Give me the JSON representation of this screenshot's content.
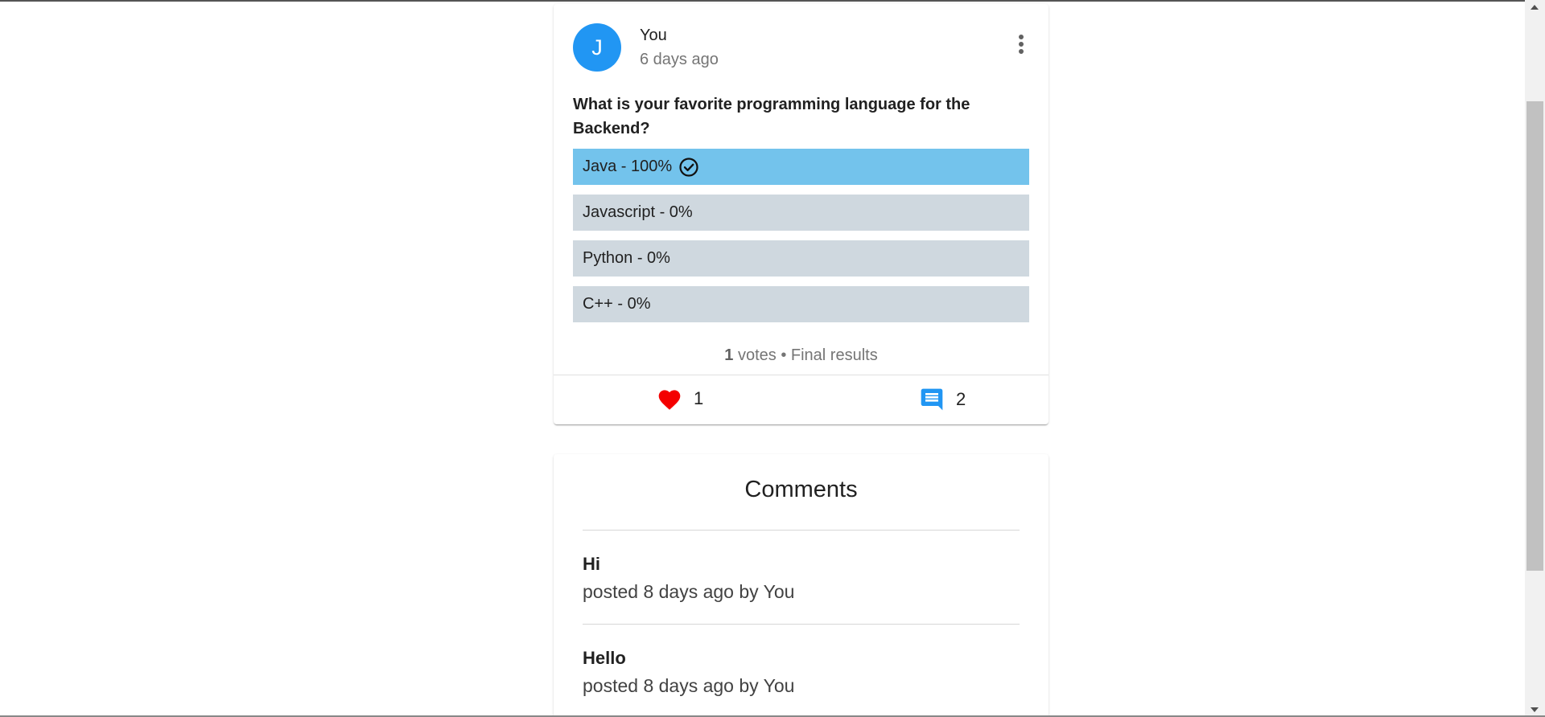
{
  "post": {
    "avatar_letter": "J",
    "author": "You",
    "time": "6 days ago",
    "question": "What is your favorite programming language for the Backend?",
    "options": [
      {
        "label": "Java - 100%",
        "selected": true,
        "percent": 100
      },
      {
        "label": "Javascript - 0%",
        "selected": false,
        "percent": 0
      },
      {
        "label": "Python - 0%",
        "selected": false,
        "percent": 0
      },
      {
        "label": "C++ - 0%",
        "selected": false,
        "percent": 0
      }
    ],
    "votes_count": "1",
    "votes_suffix": " votes • Final results",
    "likes": "1",
    "comments": "2"
  },
  "comments_section": {
    "title": "Comments",
    "items": [
      {
        "text": "Hi",
        "meta": "posted 8 days ago by You"
      },
      {
        "text": "Hello",
        "meta": "posted 8 days ago by You"
      }
    ]
  },
  "colors": {
    "avatar": "#2196f3",
    "selected_option": "#73c3ec",
    "option": "#cfd8df",
    "like": "#f40000",
    "comment": "#2196f3"
  }
}
